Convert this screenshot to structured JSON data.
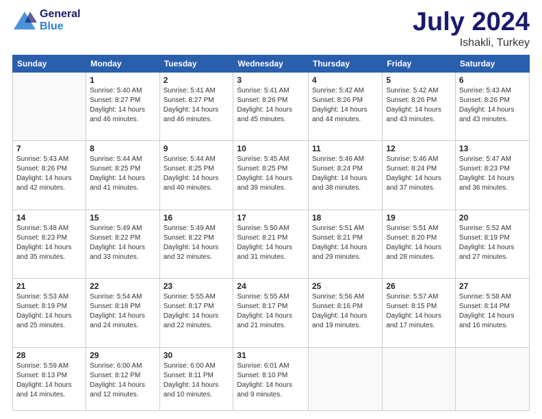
{
  "logo": {
    "line1": "General",
    "line2": "Blue"
  },
  "title": "July 2024",
  "location": "Ishakli, Turkey",
  "weekdays": [
    "Sunday",
    "Monday",
    "Tuesday",
    "Wednesday",
    "Thursday",
    "Friday",
    "Saturday"
  ],
  "weeks": [
    [
      {
        "day": "",
        "info": ""
      },
      {
        "day": "1",
        "info": "Sunrise: 5:40 AM\nSunset: 8:27 PM\nDaylight: 14 hours\nand 46 minutes."
      },
      {
        "day": "2",
        "info": "Sunrise: 5:41 AM\nSunset: 8:27 PM\nDaylight: 14 hours\nand 46 minutes."
      },
      {
        "day": "3",
        "info": "Sunrise: 5:41 AM\nSunset: 8:26 PM\nDaylight: 14 hours\nand 45 minutes."
      },
      {
        "day": "4",
        "info": "Sunrise: 5:42 AM\nSunset: 8:26 PM\nDaylight: 14 hours\nand 44 minutes."
      },
      {
        "day": "5",
        "info": "Sunrise: 5:42 AM\nSunset: 8:26 PM\nDaylight: 14 hours\nand 43 minutes."
      },
      {
        "day": "6",
        "info": "Sunrise: 5:43 AM\nSunset: 8:26 PM\nDaylight: 14 hours\nand 43 minutes."
      }
    ],
    [
      {
        "day": "7",
        "info": "Sunrise: 5:43 AM\nSunset: 8:26 PM\nDaylight: 14 hours\nand 42 minutes."
      },
      {
        "day": "8",
        "info": "Sunrise: 5:44 AM\nSunset: 8:25 PM\nDaylight: 14 hours\nand 41 minutes."
      },
      {
        "day": "9",
        "info": "Sunrise: 5:44 AM\nSunset: 8:25 PM\nDaylight: 14 hours\nand 40 minutes."
      },
      {
        "day": "10",
        "info": "Sunrise: 5:45 AM\nSunset: 8:25 PM\nDaylight: 14 hours\nand 39 minutes."
      },
      {
        "day": "11",
        "info": "Sunrise: 5:46 AM\nSunset: 8:24 PM\nDaylight: 14 hours\nand 38 minutes."
      },
      {
        "day": "12",
        "info": "Sunrise: 5:46 AM\nSunset: 8:24 PM\nDaylight: 14 hours\nand 37 minutes."
      },
      {
        "day": "13",
        "info": "Sunrise: 5:47 AM\nSunset: 8:23 PM\nDaylight: 14 hours\nand 36 minutes."
      }
    ],
    [
      {
        "day": "14",
        "info": "Sunrise: 5:48 AM\nSunset: 8:23 PM\nDaylight: 14 hours\nand 35 minutes."
      },
      {
        "day": "15",
        "info": "Sunrise: 5:49 AM\nSunset: 8:22 PM\nDaylight: 14 hours\nand 33 minutes."
      },
      {
        "day": "16",
        "info": "Sunrise: 5:49 AM\nSunset: 8:22 PM\nDaylight: 14 hours\nand 32 minutes."
      },
      {
        "day": "17",
        "info": "Sunrise: 5:50 AM\nSunset: 8:21 PM\nDaylight: 14 hours\nand 31 minutes."
      },
      {
        "day": "18",
        "info": "Sunrise: 5:51 AM\nSunset: 8:21 PM\nDaylight: 14 hours\nand 29 minutes."
      },
      {
        "day": "19",
        "info": "Sunrise: 5:51 AM\nSunset: 8:20 PM\nDaylight: 14 hours\nand 28 minutes."
      },
      {
        "day": "20",
        "info": "Sunrise: 5:52 AM\nSunset: 8:19 PM\nDaylight: 14 hours\nand 27 minutes."
      }
    ],
    [
      {
        "day": "21",
        "info": "Sunrise: 5:53 AM\nSunset: 8:19 PM\nDaylight: 14 hours\nand 25 minutes."
      },
      {
        "day": "22",
        "info": "Sunrise: 5:54 AM\nSunset: 8:18 PM\nDaylight: 14 hours\nand 24 minutes."
      },
      {
        "day": "23",
        "info": "Sunrise: 5:55 AM\nSunset: 8:17 PM\nDaylight: 14 hours\nand 22 minutes."
      },
      {
        "day": "24",
        "info": "Sunrise: 5:55 AM\nSunset: 8:17 PM\nDaylight: 14 hours\nand 21 minutes."
      },
      {
        "day": "25",
        "info": "Sunrise: 5:56 AM\nSunset: 8:16 PM\nDaylight: 14 hours\nand 19 minutes."
      },
      {
        "day": "26",
        "info": "Sunrise: 5:57 AM\nSunset: 8:15 PM\nDaylight: 14 hours\nand 17 minutes."
      },
      {
        "day": "27",
        "info": "Sunrise: 5:58 AM\nSunset: 8:14 PM\nDaylight: 14 hours\nand 16 minutes."
      }
    ],
    [
      {
        "day": "28",
        "info": "Sunrise: 5:59 AM\nSunset: 8:13 PM\nDaylight: 14 hours\nand 14 minutes."
      },
      {
        "day": "29",
        "info": "Sunrise: 6:00 AM\nSunset: 8:12 PM\nDaylight: 14 hours\nand 12 minutes."
      },
      {
        "day": "30",
        "info": "Sunrise: 6:00 AM\nSunset: 8:11 PM\nDaylight: 14 hours\nand 10 minutes."
      },
      {
        "day": "31",
        "info": "Sunrise: 6:01 AM\nSunset: 8:10 PM\nDaylight: 14 hours\nand 9 minutes."
      },
      {
        "day": "",
        "info": ""
      },
      {
        "day": "",
        "info": ""
      },
      {
        "day": "",
        "info": ""
      }
    ]
  ]
}
